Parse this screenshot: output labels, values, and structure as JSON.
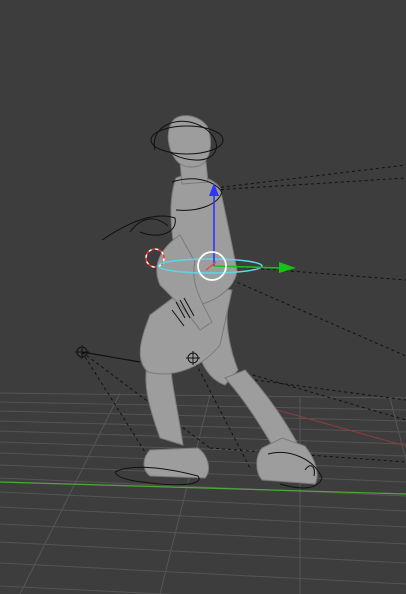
{
  "viewport": {
    "mode": "3d-viewport",
    "background": "#3d3d3d",
    "grid_color": "#5a5a5a",
    "x_axis_color": "#c85a5a",
    "y_axis_color": "#6fb04f"
  },
  "character": {
    "mesh_color": "#9d9d9d",
    "rig_line_color": "#111111"
  },
  "manipulator": {
    "z_arrow_color": "#2f34ff",
    "y_arrow_color": "#19c019",
    "ring_color": "#5ad7e6",
    "center_color": "#ffffff"
  },
  "cursor": {
    "icon": "3d-cursor-icon",
    "colors": [
      "#ff3030",
      "#ffffff"
    ]
  },
  "ik_targets": [
    {
      "icon": "ik-target-crosshair-icon"
    },
    {
      "icon": "ik-target-crosshair-icon"
    }
  ]
}
